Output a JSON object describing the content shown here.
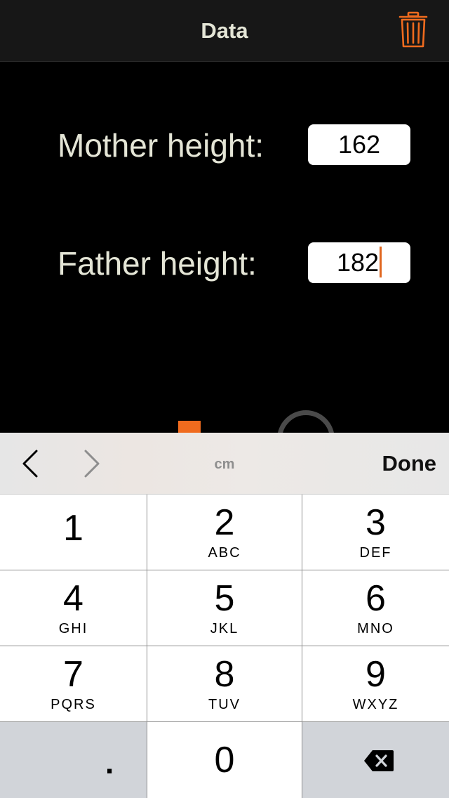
{
  "navbar": {
    "title": "Data",
    "trash_icon": "trash-icon",
    "accent_color": "#f06b1e"
  },
  "form": {
    "mother_label": "Mother height:",
    "mother_value": "162",
    "father_label": "Father height:",
    "father_value": "182"
  },
  "keyboard_accessory": {
    "prev_icon": "chevron-left-icon",
    "next_icon": "chevron-right-icon",
    "unit": "cm",
    "done_label": "Done"
  },
  "keypad": {
    "keys": [
      {
        "digit": "1",
        "letters": ""
      },
      {
        "digit": "2",
        "letters": "ABC"
      },
      {
        "digit": "3",
        "letters": "DEF"
      },
      {
        "digit": "4",
        "letters": "GHI"
      },
      {
        "digit": "5",
        "letters": "JKL"
      },
      {
        "digit": "6",
        "letters": "MNO"
      },
      {
        "digit": "7",
        "letters": "PQRS"
      },
      {
        "digit": "8",
        "letters": "TUV"
      },
      {
        "digit": "9",
        "letters": "WXYZ"
      }
    ],
    "decimal": ".",
    "zero": "0",
    "backspace_icon": "backspace-icon"
  }
}
